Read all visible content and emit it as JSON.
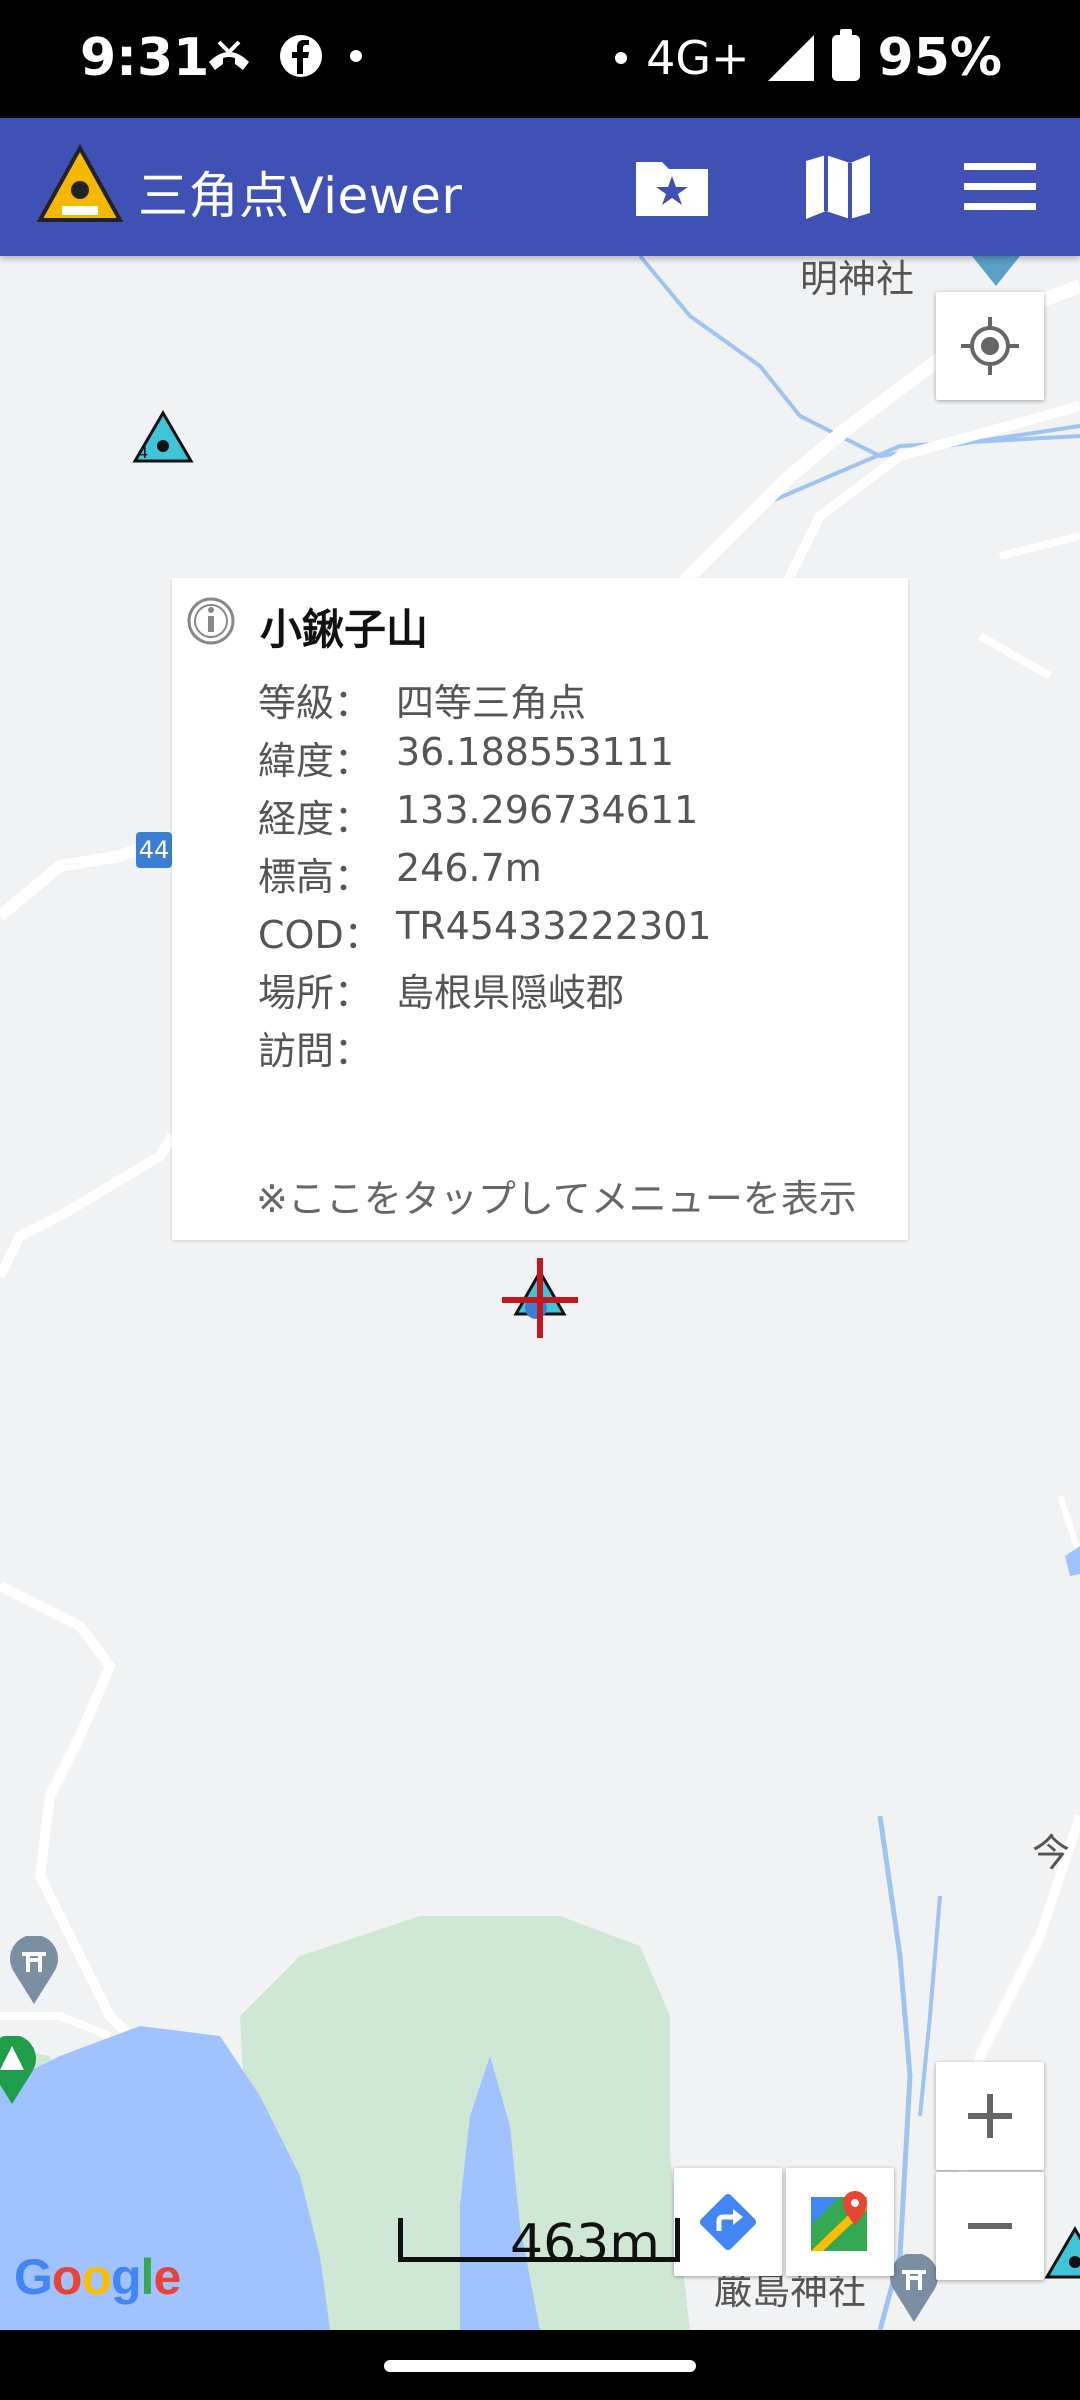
{
  "status_bar": {
    "time": "9:31",
    "network": "4G+",
    "battery": "95%",
    "icons": [
      "missed-call-icon",
      "facebook-icon",
      "dot-icon"
    ]
  },
  "app_bar": {
    "title": "三角点Viewer",
    "actions": [
      "folder-star-icon",
      "map-icon",
      "menu-icon"
    ]
  },
  "map": {
    "place_labels": {
      "top_shrine": "明神社",
      "right_edge": "今",
      "shrine_bottom": "厳島神社",
      "road_number": "44"
    },
    "scale": "463m",
    "attribution": "Google"
  },
  "popup": {
    "title": "小鍬子山",
    "rows": [
      {
        "key": "等級：",
        "value": "四等三角点"
      },
      {
        "key": "緯度：",
        "value": "36.188553111"
      },
      {
        "key": "経度：",
        "value": "133.296734611"
      },
      {
        "key": "標高：",
        "value": "246.7m"
      },
      {
        "key": "COD：",
        "value": "TR45433222301"
      },
      {
        "key": "場所：",
        "value": "島根県隠岐郡"
      },
      {
        "key": "訪問：",
        "value": ""
      }
    ],
    "hint": "※ここをタップしてメニューを表示"
  },
  "colors": {
    "app_bar": "#3f51b5",
    "water": "#a0c3ff",
    "park": "#cfe8d5",
    "road": "#ffffff",
    "river": "#9ec4f2"
  }
}
